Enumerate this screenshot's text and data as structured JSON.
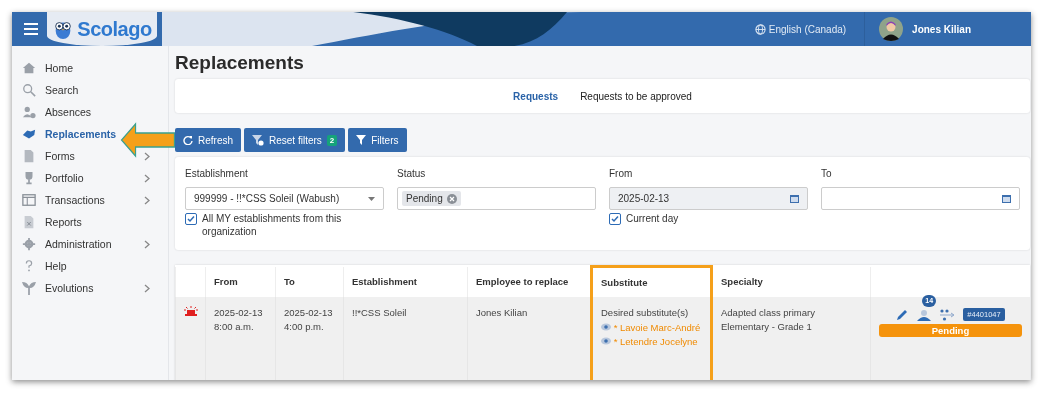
{
  "header": {
    "logo": "Scolago",
    "language": "English (Canada)",
    "user": "Jones Kilian"
  },
  "sidebar": {
    "items": [
      {
        "label": "Home",
        "selected": false,
        "has_submenu": false
      },
      {
        "label": "Search",
        "selected": false,
        "has_submenu": false
      },
      {
        "label": "Absences",
        "selected": false,
        "has_submenu": false
      },
      {
        "label": "Replacements",
        "selected": true,
        "has_submenu": false
      },
      {
        "label": "Forms",
        "selected": false,
        "has_submenu": true
      },
      {
        "label": "Portfolio",
        "selected": false,
        "has_submenu": true
      },
      {
        "label": "Transactions",
        "selected": false,
        "has_submenu": true
      },
      {
        "label": "Reports",
        "selected": false,
        "has_submenu": false
      },
      {
        "label": "Administration",
        "selected": false,
        "has_submenu": true
      },
      {
        "label": "Help",
        "selected": false,
        "has_submenu": false
      },
      {
        "label": "Evolutions",
        "selected": false,
        "has_submenu": true
      }
    ]
  },
  "page_title": "Replacements",
  "tabs": [
    {
      "label": "Requests",
      "selected": true
    },
    {
      "label": "Requests to be approved",
      "selected": false
    }
  ],
  "toolbar": {
    "refresh": "Refresh",
    "reset_filters": "Reset filters",
    "reset_count": "2",
    "filters": "Filters"
  },
  "filters": {
    "establishment": {
      "label": "Establishment",
      "value": "999999 - !!*CSS Soleil (Wabush)",
      "checkbox": {
        "label": "All MY establishments from this organization",
        "checked": true
      }
    },
    "status": {
      "label": "Status",
      "tags": [
        "Pending"
      ]
    },
    "from": {
      "label": "From",
      "value": "2025-02-13",
      "disabled": true,
      "checkbox": {
        "label": "Current day",
        "checked": true
      }
    },
    "to": {
      "label": "To"
    }
  },
  "table": {
    "columns": [
      {
        "highlighted": false
      },
      {
        "label": "From",
        "highlighted": false
      },
      {
        "label": "To",
        "highlighted": false
      },
      {
        "label": "Establishment",
        "highlighted": false
      },
      {
        "label": "Employee to replace",
        "highlighted": false
      },
      {
        "label": "Substitute",
        "highlighted": true
      },
      {
        "label": "Specialty",
        "highlighted": false
      },
      {
        "highlighted": false
      }
    ],
    "rows": [
      {
        "urgent": true,
        "from": [
          "2025-02-13",
          "8:00 a.m."
        ],
        "to": [
          "2025-02-13",
          "4:00 p.m."
        ],
        "establishment": "!!*CSS Soleil",
        "employee": "Jones Kilian",
        "substitute": {
          "heading": "Desired substitute(s)",
          "names": [
            "* Lavoie Marc-André",
            "* Letendre Jocelyne"
          ]
        },
        "specialty": [
          "Adapted class primary",
          "Elementary - Grade 1"
        ],
        "candidates": "14",
        "reference": "#4401047",
        "status": "Pending"
      }
    ]
  }
}
